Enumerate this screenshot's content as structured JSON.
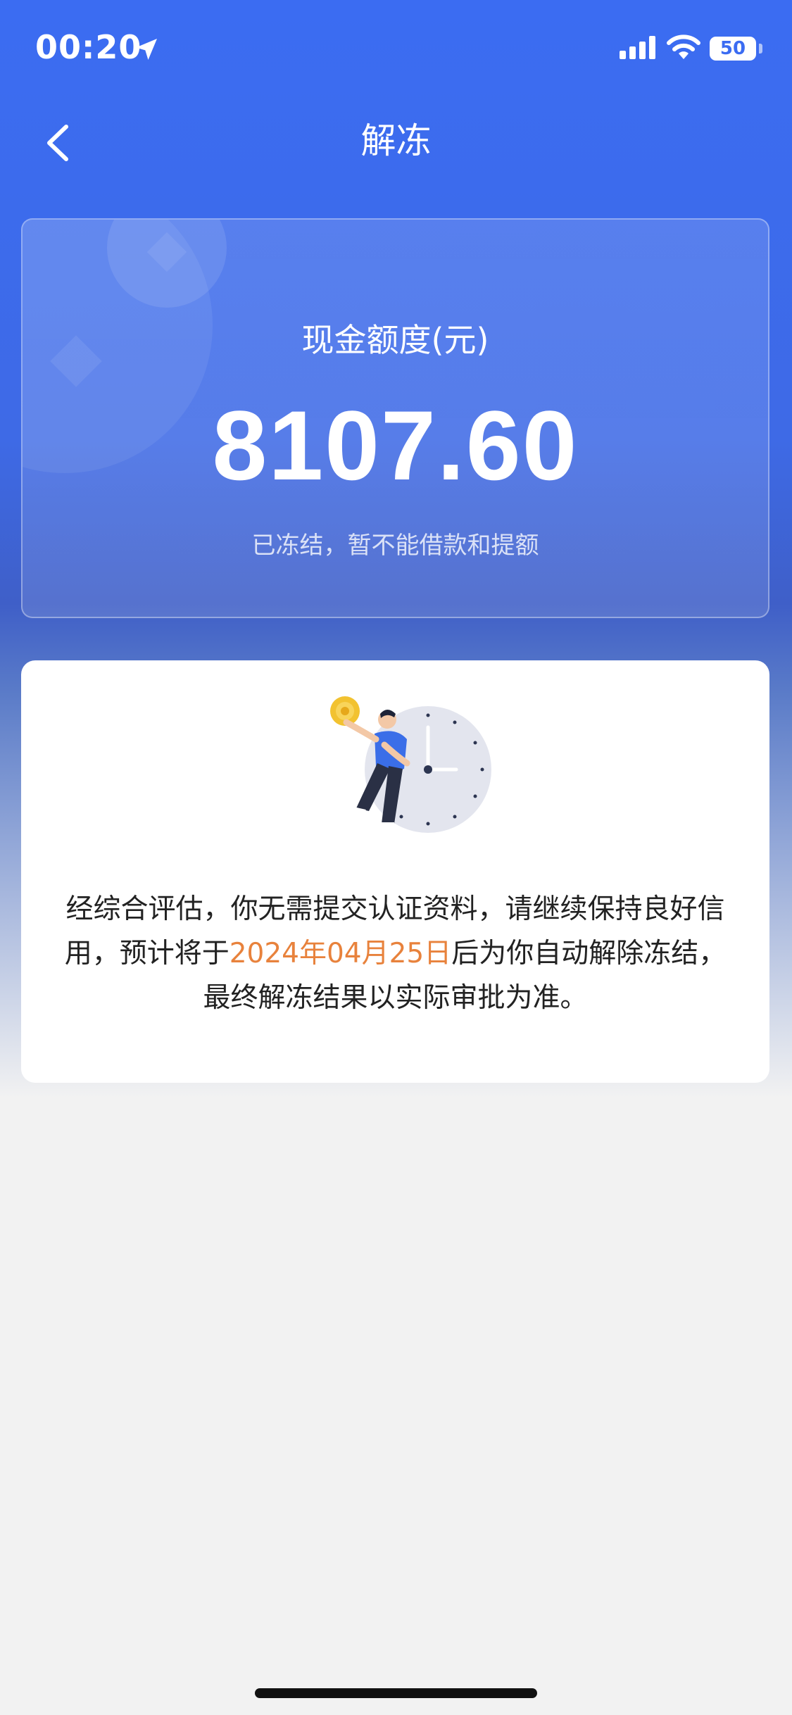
{
  "status_bar": {
    "time": "00:20",
    "battery": "50"
  },
  "nav": {
    "title": "解冻",
    "back_icon": "chevron-left-icon"
  },
  "quota": {
    "label": "现金额度(元)",
    "amount": "8107.60",
    "status": "已冻结，暂不能借款和提额"
  },
  "info": {
    "text_before": "经综合评估，你无需提交认证资料，请继续保持良好信用，预计将于",
    "date": "2024年04月25日",
    "text_after": "后为你自动解除冻结，最终解冻结果以实际审批为准。"
  },
  "colors": {
    "primary": "#3b6cf2",
    "highlight": "#e8823c",
    "background": "#f2f2f2"
  }
}
